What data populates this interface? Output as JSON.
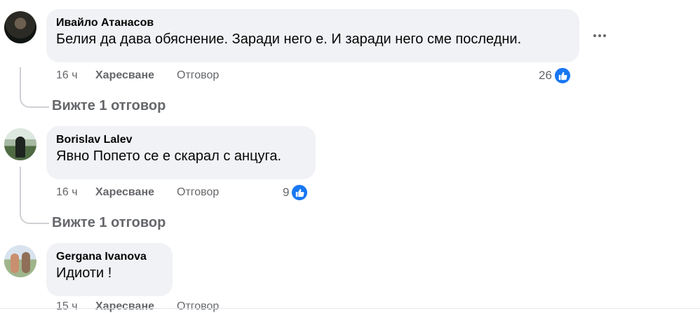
{
  "comments": [
    {
      "author": "Ивайло Атанасов",
      "text": "Белия да дава обяснение. Заради него е. И заради него сме последни.",
      "time": "16 ч",
      "like_label": "Харесване",
      "reply_label": "Отговор",
      "reactions": "26",
      "view_replies": "Вижте 1 отговор"
    },
    {
      "author": "Borislav Lalev",
      "text": "Явно Попето се е скарал с анцуга.",
      "time": "16 ч",
      "like_label": "Харесване",
      "reply_label": "Отговор",
      "reactions": "9",
      "view_replies": "Вижте 1 отговор"
    },
    {
      "author": "Gergana Ivanova",
      "text": "Идиоти !",
      "time": "15 ч",
      "like_label": "Харесване",
      "reply_label": "Отговор"
    }
  ],
  "icons": {
    "like": "thumbs-up-icon",
    "more": "more-options-icon"
  },
  "colors": {
    "bubble": "#f0f2f5",
    "meta_text": "#65676b",
    "like_blue": "#1877f2"
  }
}
